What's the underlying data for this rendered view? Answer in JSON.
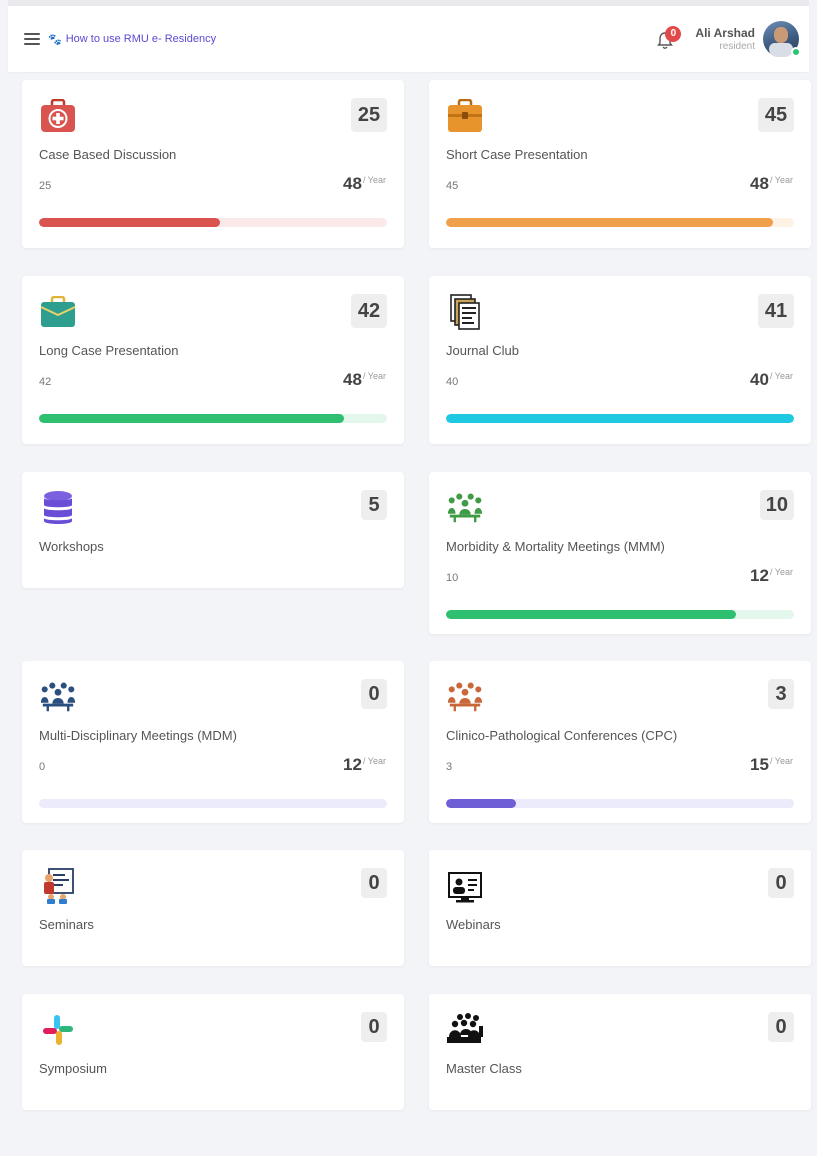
{
  "header": {
    "tour_link": "How to use RMU e- Residency",
    "notifications_count": "0",
    "user_name": "Ali Arshad",
    "user_role": "resident"
  },
  "colors": {
    "accent": "#5a4bd1",
    "red": "#d9534f",
    "orange": "#f0a04b",
    "green": "#2fbf71",
    "cyan": "#1ec8e0",
    "purple": "#6f5fd6",
    "badge": "#e24a4a"
  },
  "cards": [
    {
      "key": "cbd",
      "icon": "first-aid-kit-icon",
      "title": "Case Based Discussion",
      "count": "25",
      "done": "25",
      "target": "48",
      "unit": "/ Year",
      "progress": 0.52,
      "bar_color": "#d9534f",
      "track_color": "#fbe9e9"
    },
    {
      "key": "scp",
      "icon": "briefcase-icon",
      "title": "Short Case Presentation",
      "count": "45",
      "done": "45",
      "target": "48",
      "unit": "/ Year",
      "progress": 0.94,
      "bar_color": "#f0a04b",
      "track_color": "#fdf2e4"
    },
    {
      "key": "lcp",
      "icon": "case-bag-icon",
      "title": "Long Case Presentation",
      "count": "42",
      "done": "42",
      "target": "48",
      "unit": "/ Year",
      "progress": 0.875,
      "bar_color": "#2fbf71",
      "track_color": "#e3f7ec"
    },
    {
      "key": "jc",
      "icon": "journal-icon",
      "title": "Journal Club",
      "count": "41",
      "done": "40",
      "target": "40",
      "unit": "/ Year",
      "progress": 1.0,
      "bar_color": "#1ec8e0",
      "track_color": "#e0f8fb"
    },
    {
      "key": "ws",
      "icon": "database-icon",
      "title": "Workshops",
      "count": "5"
    },
    {
      "key": "mmm",
      "icon": "meeting-group-icon",
      "title": "Morbidity & Mortality Meetings (MMM)",
      "count": "10",
      "done": "10",
      "target": "12",
      "unit": "/ Year",
      "progress": 0.833,
      "bar_color": "#2fbf71",
      "track_color": "#e3f7ec"
    },
    {
      "key": "mdm",
      "icon": "meeting-group-icon",
      "title": "Multi-Disciplinary Meetings (MDM)",
      "count": "0",
      "done": "0",
      "target": "12",
      "unit": "/ Year",
      "progress": 0.0,
      "bar_color": "#6f5fd6",
      "track_color": "#ecebfb"
    },
    {
      "key": "cpc",
      "icon": "meeting-group-icon",
      "title": "Clinico-Pathological Conferences (CPC)",
      "count": "3",
      "done": "3",
      "target": "15",
      "unit": "/ Year",
      "progress": 0.2,
      "bar_color": "#6f5fd6",
      "track_color": "#ecebfb"
    },
    {
      "key": "sem",
      "icon": "seminar-board-icon",
      "title": "Seminars",
      "count": "0"
    },
    {
      "key": "web",
      "icon": "webinar-screen-icon",
      "title": "Webinars",
      "count": "0"
    },
    {
      "key": "sym",
      "icon": "symposium-icon",
      "title": "Symposium",
      "count": "0"
    },
    {
      "key": "mc",
      "icon": "master-class-icon",
      "title": "Master Class",
      "count": "0"
    }
  ]
}
